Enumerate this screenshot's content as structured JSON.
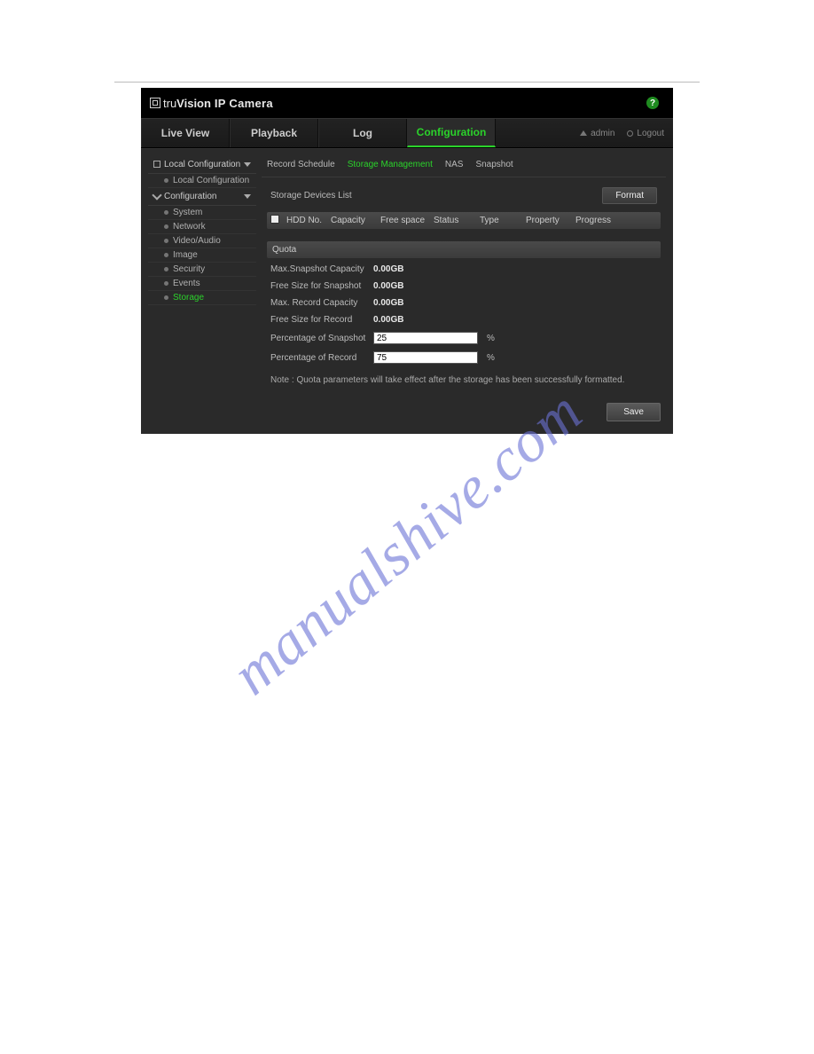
{
  "brand_part1": "tru",
  "brand_part2": "Vision",
  "brand_suffix": " IP Camera",
  "help_glyph": "?",
  "topnav": {
    "live_view": "Live View",
    "playback": "Playback",
    "log": "Log",
    "configuration": "Configuration"
  },
  "user": {
    "name": "admin",
    "logout": "Logout"
  },
  "sidebar": {
    "local_config_header": "Local Configuration",
    "local_config_item": "Local Configuration",
    "config_header": "Configuration",
    "items": [
      {
        "label": "System"
      },
      {
        "label": "Network"
      },
      {
        "label": "Video/Audio"
      },
      {
        "label": "Image"
      },
      {
        "label": "Security"
      },
      {
        "label": "Events"
      },
      {
        "label": "Storage"
      }
    ]
  },
  "tabs": {
    "record_schedule": "Record Schedule",
    "storage_management": "Storage Management",
    "nas": "NAS",
    "snapshot": "Snapshot"
  },
  "storage_list_title": "Storage Devices List",
  "format_button": "Format",
  "columns": {
    "hdd_no": "HDD No.",
    "capacity": "Capacity",
    "free_space": "Free space",
    "status": "Status",
    "type": "Type",
    "property": "Property",
    "progress": "Progress"
  },
  "quota_title": "Quota",
  "quota": {
    "max_snapshot_capacity_label": "Max.Snapshot Capacity",
    "max_snapshot_capacity_value": "0.00GB",
    "free_size_snapshot_label": "Free Size for Snapshot",
    "free_size_snapshot_value": "0.00GB",
    "max_record_capacity_label": "Max. Record Capacity",
    "max_record_capacity_value": "0.00GB",
    "free_size_record_label": "Free Size for Record",
    "free_size_record_value": "0.00GB",
    "pct_snapshot_label": "Percentage of Snapshot",
    "pct_snapshot_value": "25",
    "pct_record_label": "Percentage of Record",
    "pct_record_value": "75",
    "pct_unit": "%"
  },
  "note": "Note :  Quota parameters will take effect after the storage has been successfully formatted.",
  "save_button": "Save",
  "watermark": "manualshive.com"
}
